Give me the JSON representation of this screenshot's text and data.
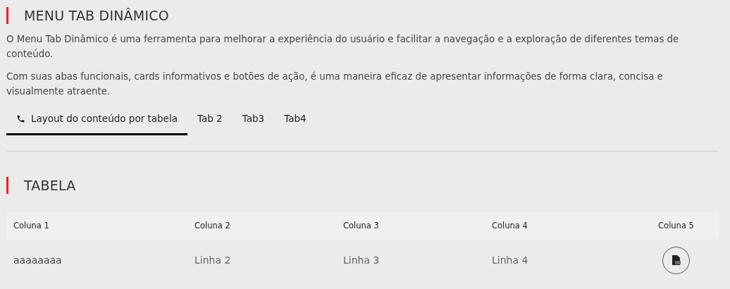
{
  "heading": "MENU TAB DINÂMICO",
  "paragraphs": [
    "O Menu Tab Dinâmico é uma ferramenta para melhorar a experiência do usuário e facilitar a navegação e a exploração de diferentes temas de conteúdo.",
    "Com suas abas funcionais, cards informativos e botões de ação, é uma maneira eficaz de apresentar informações de forma clara, concisa e visualmente atraente."
  ],
  "tabs": [
    {
      "label": "Layout do conteúdo por tabela",
      "selected": true
    },
    {
      "label": "Tab 2",
      "selected": false
    },
    {
      "label": "Tab3",
      "selected": false
    },
    {
      "label": "Tab4",
      "selected": false
    }
  ],
  "section_title": "TABELA",
  "table": {
    "columns": [
      "Coluna 1",
      "Coluna 2",
      "Coluna 3",
      "Coluna 4",
      "Coluna 5"
    ],
    "rows": [
      {
        "cells": [
          "aaaaaaaa",
          "Linha 2",
          "Linha 3",
          "Linha 4"
        ]
      }
    ]
  }
}
